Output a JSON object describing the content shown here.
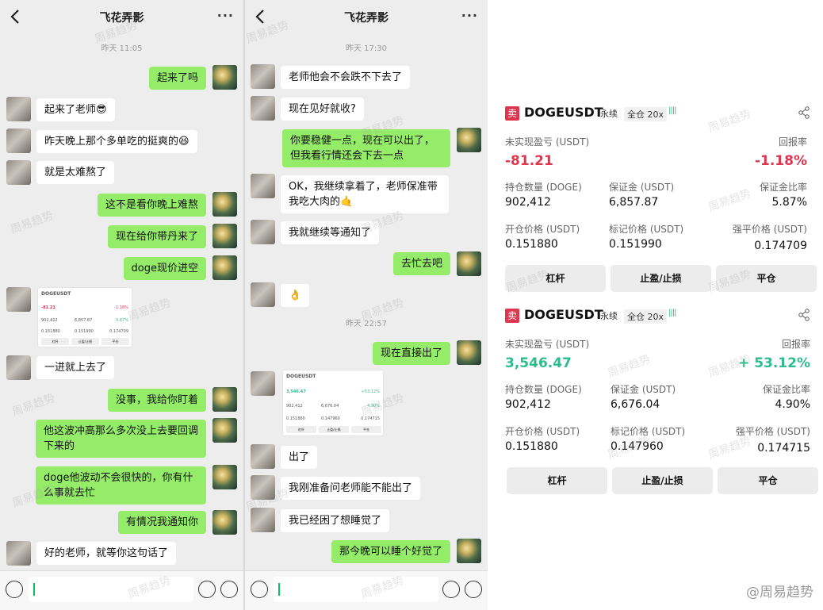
{
  "chat_left": {
    "title": "飞花弄影",
    "time": "昨天 11:05",
    "messages": [
      {
        "side": "me",
        "text": "起来了吗"
      },
      {
        "side": "other",
        "text": "起来了老师😎"
      },
      {
        "side": "other",
        "text": "昨天晚上那个多单吃的挺爽的😆"
      },
      {
        "side": "other",
        "text": "就是太难熬了"
      },
      {
        "side": "me",
        "text": "这不是看你晚上难熬"
      },
      {
        "side": "me",
        "text": "现在给你带丹来了"
      },
      {
        "side": "me",
        "text": "doge现价进空"
      },
      {
        "side": "other",
        "type": "image"
      },
      {
        "side": "other",
        "text": "一进就上去了"
      },
      {
        "side": "me",
        "text": "没事，我给你盯着"
      },
      {
        "side": "me",
        "text": "他这波冲高那么多次没上去要回调下来的"
      },
      {
        "side": "me",
        "text": "doge他波动不会很快的，你有什么事就去忙"
      },
      {
        "side": "me",
        "text": "有情况我通知你"
      },
      {
        "side": "other",
        "text": "好的老师，就等你这句话了"
      }
    ]
  },
  "chat_right": {
    "title": "飞花弄影",
    "time1": "昨天 17:30",
    "time2": "昨天 22:57",
    "messages": [
      {
        "side": "other",
        "text": "老师他会不会跌不下去了"
      },
      {
        "side": "other",
        "text": "现在见好就收?"
      },
      {
        "side": "me",
        "text": "你要稳健一点，现在可以出了，但我看行情还会下去一点"
      },
      {
        "side": "other",
        "text": "OK，我继续拿着了，老师保准带我吃大肉的🤙"
      },
      {
        "side": "other",
        "text": "我就继续等通知了"
      },
      {
        "side": "me",
        "text": "去忙去吧"
      },
      {
        "side": "other",
        "text": "👌"
      },
      {
        "side": "me",
        "text": "现在直接出了"
      },
      {
        "side": "other",
        "type": "image"
      },
      {
        "side": "other",
        "text": "出了"
      },
      {
        "side": "other",
        "text": "我刚准备问老师能不能出了"
      },
      {
        "side": "other",
        "text": "我已经困了想睡觉了"
      },
      {
        "side": "me",
        "text": "那今晚可以睡个好觉了"
      }
    ]
  },
  "card1": {
    "side": "卖",
    "symbol": "DOGEUSDT",
    "tag1": "永续",
    "tag2": "全仓 20x",
    "pnl_label": "未实现盈亏 (USDT)",
    "pnl": "-81.21",
    "roe_label": "回报率",
    "roe": "-1.18%",
    "qty_label": "持仓数量 (DOGE)",
    "qty": "902,412",
    "margin_label": "保证金 (USDT)",
    "margin": "6,857.87",
    "ratio_label": "保证金比率",
    "ratio": "5.87%",
    "open_label": "开仓价格 (USDT)",
    "open": "0.151880",
    "mark_label": "标记价格 (USDT)",
    "mark": "0.151990",
    "liq_label": "强平价格 (USDT)",
    "liq": "0.174709",
    "btn1": "杠杆",
    "btn2": "止盈/止损",
    "btn3": "平仓"
  },
  "card2": {
    "side": "卖",
    "symbol": "DOGEUSDT",
    "tag1": "永续",
    "tag2": "全仓 20x",
    "pnl_label": "未实现盈亏 (USDT)",
    "pnl": "3,546.47",
    "roe_label": "回报率",
    "roe": "+ 53.12%",
    "qty_label": "持仓数量 (DOGE)",
    "qty": "902,412",
    "margin_label": "保证金 (USDT)",
    "margin": "6,676.04",
    "ratio_label": "保证金比率",
    "ratio": "4.90%",
    "open_label": "开仓价格 (USDT)",
    "open": "0.151880",
    "mark_label": "标记价格 (USDT)",
    "mark": "0.147960",
    "liq_label": "强平价格 (USDT)",
    "liq": "0.174715",
    "btn1": "杠杆",
    "btn2": "止盈/止损",
    "btn3": "平仓"
  },
  "thumb1": {
    "symbol": "DOGEUSDT",
    "pnl": "-81.21",
    "roe": "-1.18%",
    "qty": "902,412",
    "margin": "6,857.87",
    "ratio": "5.87%",
    "open": "0.151880",
    "mark": "0.151990",
    "liq": "0.174709",
    "btn1": "杠杆",
    "btn2": "止盈/止损",
    "btn3": "平仓"
  },
  "thumb2": {
    "symbol": "DOGEUSDT",
    "pnl": "3,546.47",
    "roe": "+53.12%",
    "qty": "902,412",
    "margin": "6,676.04",
    "ratio": "4.90%",
    "open": "0.151880",
    "mark": "0.147960",
    "liq": "0.174715",
    "btn1": "杠杆",
    "btn2": "止盈/止损",
    "btn3": "平仓"
  },
  "watermark": "周易趋势",
  "brand": "@周易趋势",
  "colors": {
    "bubble_me": "#95ec69",
    "bubble_other": "#ffffff",
    "red": "#e0354f",
    "green": "#2dbd8c",
    "chat_bg": "#ededed"
  }
}
